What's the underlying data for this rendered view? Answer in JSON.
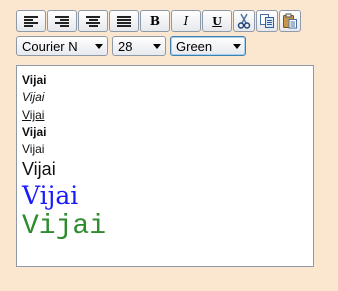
{
  "toolbar": {
    "bold_label": "B",
    "italic_label": "I",
    "underline_label": "U"
  },
  "icons": [
    "align-left-icon",
    "align-right-icon",
    "align-center-icon",
    "align-justify-icon",
    "bold-icon",
    "italic-icon",
    "underline-icon",
    "cut-icon",
    "copy-icon",
    "paste-icon"
  ],
  "format_bar": {
    "font_family": "Courier N",
    "font_size": "28",
    "font_color": "Green"
  },
  "editor": {
    "lines": [
      {
        "text": "Vijai",
        "style": "bold"
      },
      {
        "text": "Vijai",
        "style": "italic"
      },
      {
        "text": "Vijai",
        "style": "underline"
      },
      {
        "text": "Vijai",
        "style": "bold"
      },
      {
        "text": "Vijai",
        "style": "normal"
      },
      {
        "text": "Vijai",
        "style": "large"
      },
      {
        "text": "Vijai",
        "style": "serif",
        "color": "#1a1aff"
      },
      {
        "text": "Vijai",
        "style": "monospace",
        "color": "#2e8b2e"
      }
    ]
  }
}
